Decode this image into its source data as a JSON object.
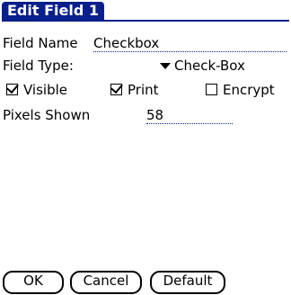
{
  "window": {
    "title": "Edit Field 1"
  },
  "fields": {
    "name": {
      "label": "Field Name",
      "value": "Checkbox"
    },
    "type": {
      "label": "Field Type:",
      "value": "Check-Box"
    },
    "options": {
      "visible": {
        "label": "Visible",
        "checked": true
      },
      "print": {
        "label": "Print",
        "checked": true
      },
      "encrypt": {
        "label": "Encrypt",
        "checked": false
      }
    },
    "pixels": {
      "label": "Pixels Shown",
      "value": "58"
    }
  },
  "buttons": {
    "ok": "OK",
    "cancel": "Cancel",
    "default": "Default"
  },
  "colors": {
    "accent": "#0a1f8c"
  }
}
